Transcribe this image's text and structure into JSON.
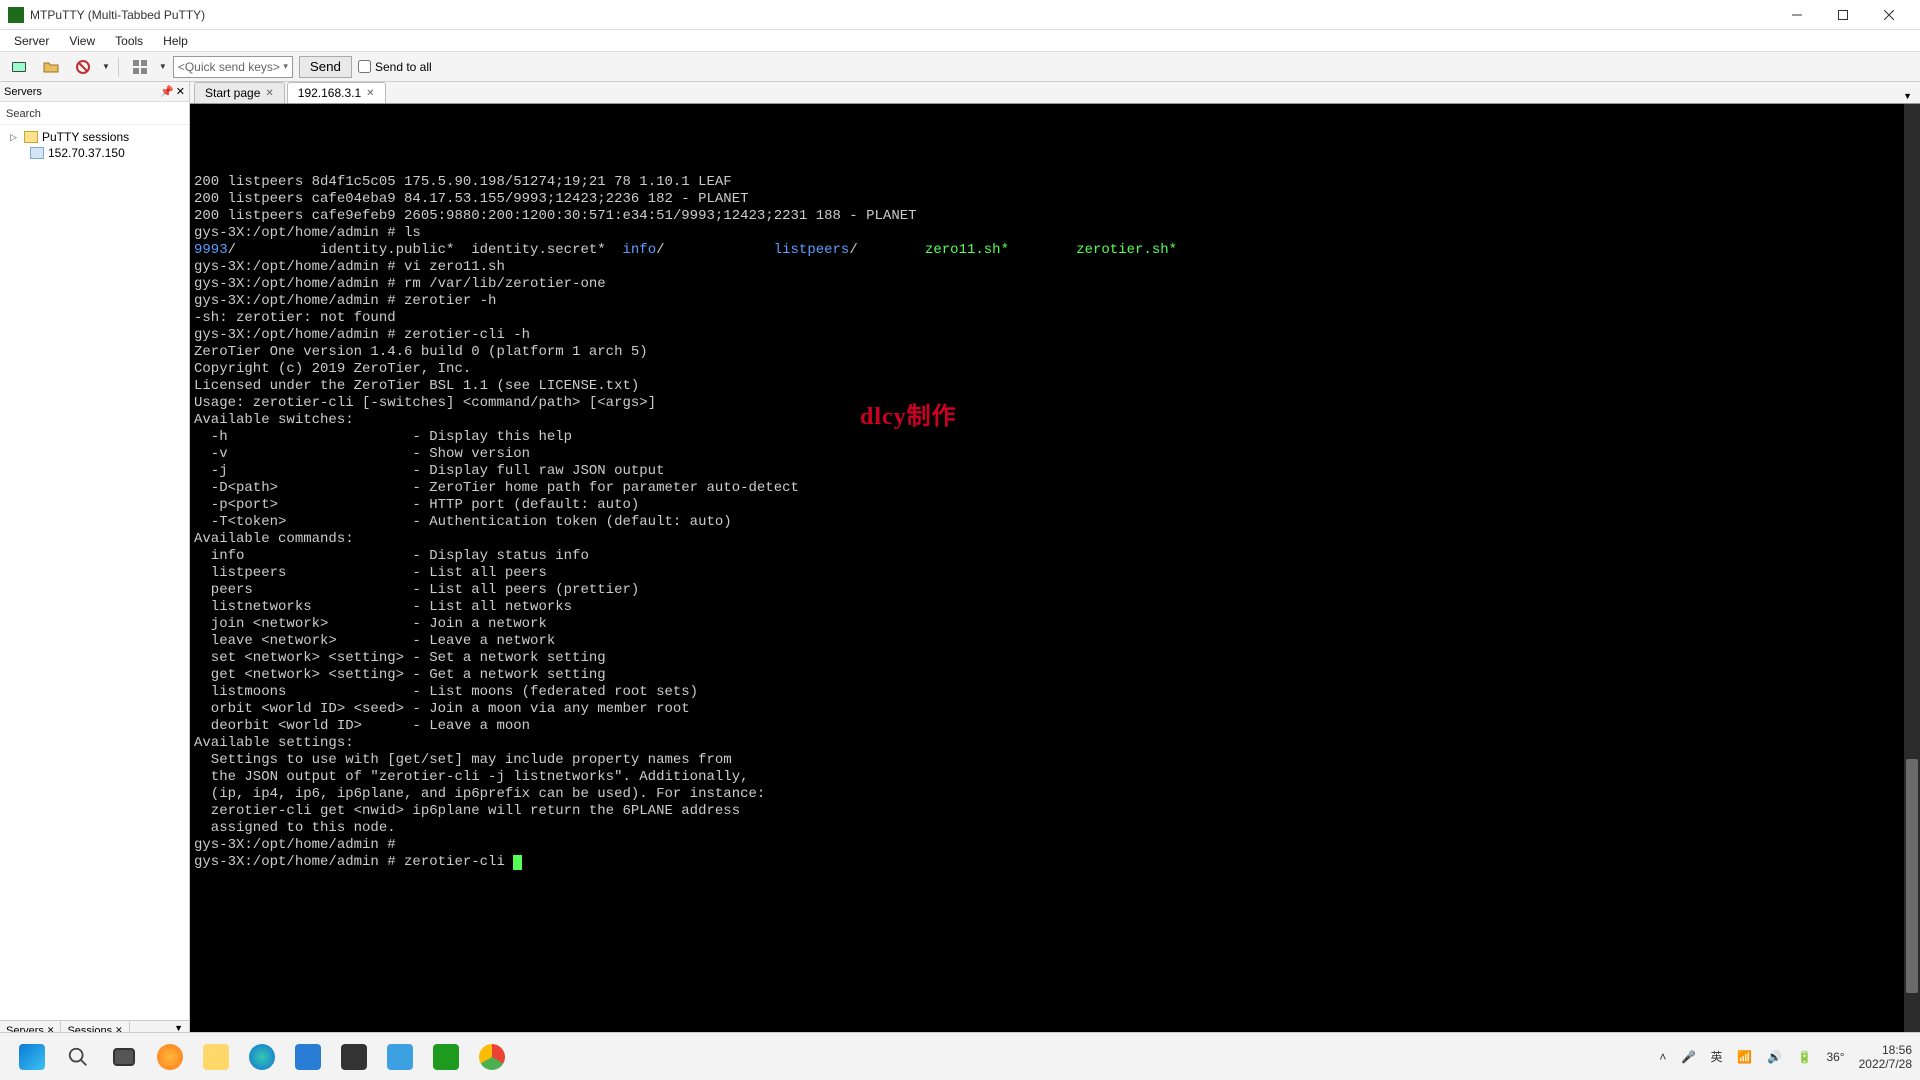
{
  "window": {
    "title": "MTPuTTY (Multi-Tabbed PuTTY)"
  },
  "menu": {
    "server": "Server",
    "view": "View",
    "tools": "Tools",
    "help": "Help"
  },
  "toolbar": {
    "quick_send_placeholder": "<Quick send keys>",
    "send_label": "Send",
    "send_all_label": "Send to all"
  },
  "sidebar": {
    "title": "Servers",
    "search_label": "Search",
    "root": "PuTTY sessions",
    "session1": "152.70.37.150",
    "tab_servers": "Servers",
    "tab_sessions": "Sessions"
  },
  "tabs": {
    "start": "Start page",
    "active": "192.168.3.1"
  },
  "terminal": {
    "lines": [
      {
        "t": "200 listpeers 8d4f1c5c05 175.5.90.198/51274;19;21 78 1.10.1 LEAF"
      },
      {
        "t": "200 listpeers cafe04eba9 84.17.53.155/9993;12423;2236 182 - PLANET"
      },
      {
        "t": "200 listpeers cafe9efeb9 2605:9880:200:1200:30:571:e34:51/9993;12423;2231 188 - PLANET"
      },
      {
        "t": "gys-3X:/opt/home/admin # ls"
      },
      {
        "seg": [
          {
            "c": "blue",
            "t": "9993"
          },
          {
            "t": "/          identity.public*  identity.secret*  "
          },
          {
            "c": "blue",
            "t": "info"
          },
          {
            "t": "/             "
          },
          {
            "c": "blue",
            "t": "listpeers"
          },
          {
            "t": "/        "
          },
          {
            "c": "green",
            "t": "zero11.sh*"
          },
          {
            "t": "        "
          },
          {
            "c": "green",
            "t": "zerotier.sh*"
          }
        ]
      },
      {
        "t": "gys-3X:/opt/home/admin # vi zero11.sh"
      },
      {
        "t": "gys-3X:/opt/home/admin # rm /var/lib/zerotier-one"
      },
      {
        "t": "gys-3X:/opt/home/admin # zerotier -h"
      },
      {
        "t": "-sh: zerotier: not found"
      },
      {
        "t": "gys-3X:/opt/home/admin # zerotier-cli -h"
      },
      {
        "t": "ZeroTier One version 1.4.6 build 0 (platform 1 arch 5)"
      },
      {
        "t": "Copyright (c) 2019 ZeroTier, Inc."
      },
      {
        "t": "Licensed under the ZeroTier BSL 1.1 (see LICENSE.txt)"
      },
      {
        "t": "Usage: zerotier-cli [-switches] <command/path> [<args>]"
      },
      {
        "t": ""
      },
      {
        "t": "Available switches:"
      },
      {
        "t": "  -h                      - Display this help"
      },
      {
        "t": "  -v                      - Show version"
      },
      {
        "t": "  -j                      - Display full raw JSON output"
      },
      {
        "t": "  -D<path>                - ZeroTier home path for parameter auto-detect"
      },
      {
        "t": "  -p<port>                - HTTP port (default: auto)"
      },
      {
        "t": "  -T<token>               - Authentication token (default: auto)"
      },
      {
        "t": ""
      },
      {
        "t": "Available commands:"
      },
      {
        "t": "  info                    - Display status info"
      },
      {
        "t": "  listpeers               - List all peers"
      },
      {
        "t": "  peers                   - List all peers (prettier)"
      },
      {
        "t": "  listnetworks            - List all networks"
      },
      {
        "t": "  join <network>          - Join a network"
      },
      {
        "t": "  leave <network>         - Leave a network"
      },
      {
        "t": "  set <network> <setting> - Set a network setting"
      },
      {
        "t": "  get <network> <setting> - Get a network setting"
      },
      {
        "t": "  listmoons               - List moons (federated root sets)"
      },
      {
        "t": "  orbit <world ID> <seed> - Join a moon via any member root"
      },
      {
        "t": "  deorbit <world ID>      - Leave a moon"
      },
      {
        "t": ""
      },
      {
        "t": "Available settings:"
      },
      {
        "t": "  Settings to use with [get/set] may include property names from"
      },
      {
        "t": "  the JSON output of \"zerotier-cli -j listnetworks\". Additionally,"
      },
      {
        "t": "  (ip, ip4, ip6, ip6plane, and ip6prefix can be used). For instance:"
      },
      {
        "t": "  zerotier-cli get <nwid> ip6plane will return the 6PLANE address"
      },
      {
        "t": "  assigned to this node."
      },
      {
        "t": "gys-3X:/opt/home/admin #"
      },
      {
        "t": "gys-3X:/opt/home/admin # zerotier-cli ",
        "cursor": true
      }
    ]
  },
  "watermark": "dlcy制作",
  "systray": {
    "temp": "36°",
    "lang": "英",
    "time": "18:56",
    "date": "2022/7/28"
  }
}
